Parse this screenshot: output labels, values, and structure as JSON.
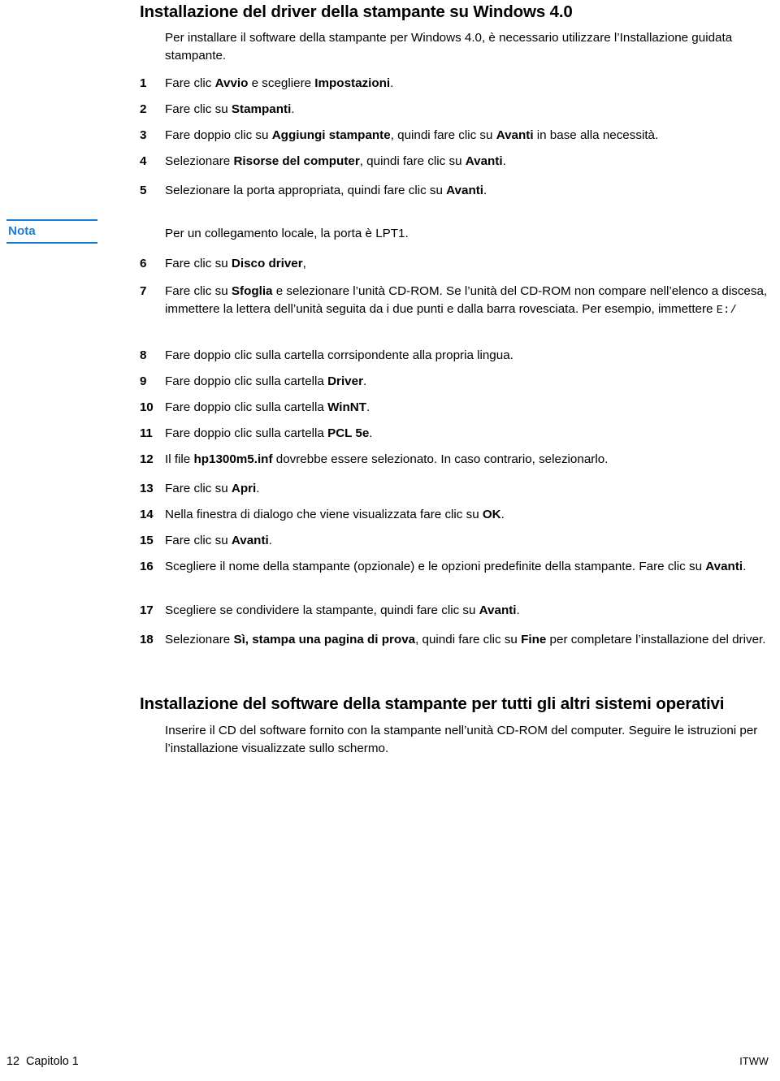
{
  "document": {
    "language": "it",
    "accent_color": "#1a7fd4",
    "text_color": "#000000",
    "background_color": "#ffffff"
  },
  "section_one": {
    "heading": "Installazione del driver della stampante su Windows 4.0",
    "intro": "Per installare il software della stampante per Windows 4.0, è necessario utilizzare l’Installazione guidata stampante.",
    "steps_before_note": [
      {
        "number": "1",
        "parts": [
          {
            "text": "Fare clic ",
            "bold": false
          },
          {
            "text": "Avvio",
            "bold": true
          },
          {
            "text": " e scegliere ",
            "bold": false
          },
          {
            "text": "Impostazioni",
            "bold": true
          },
          {
            "text": ".",
            "bold": false
          }
        ]
      },
      {
        "number": "2",
        "parts": [
          {
            "text": "Fare clic su ",
            "bold": false
          },
          {
            "text": "Stampanti",
            "bold": true
          },
          {
            "text": ".",
            "bold": false
          }
        ]
      },
      {
        "number": "3",
        "parts": [
          {
            "text": "Fare doppio clic su ",
            "bold": false
          },
          {
            "text": "Aggiungi stampante",
            "bold": true
          },
          {
            "text": ", quindi fare clic su ",
            "bold": false
          },
          {
            "text": "Avanti",
            "bold": true
          },
          {
            "text": " in base alla necessità.",
            "bold": false
          }
        ]
      },
      {
        "number": "4",
        "parts": [
          {
            "text": "Selezionare ",
            "bold": false
          },
          {
            "text": "Risorse del computer",
            "bold": true
          },
          {
            "text": ", quindi fare clic su ",
            "bold": false
          },
          {
            "text": "Avanti",
            "bold": true
          },
          {
            "text": ".",
            "bold": false
          }
        ]
      },
      {
        "number": "5",
        "parts": [
          {
            "text": "Selezionare la porta appropriata, quindi fare clic su ",
            "bold": false
          },
          {
            "text": "Avanti",
            "bold": true
          },
          {
            "text": ".",
            "bold": false
          }
        ]
      }
    ],
    "note": {
      "label": "Nota",
      "text": "Per un collegamento locale, la porta è LPT1."
    },
    "steps_after_note": [
      {
        "number": "6",
        "parts": [
          {
            "text": "Fare clic su ",
            "bold": false
          },
          {
            "text": "Disco driver",
            "bold": true
          },
          {
            "text": ",",
            "bold": false
          }
        ]
      },
      {
        "number": "7",
        "parts": [
          {
            "text": "Fare clic su ",
            "bold": false
          },
          {
            "text": "Sfoglia",
            "bold": true
          },
          {
            "text": " e selezionare l’unità CD-ROM. Se l’unità del CD-ROM non compare nell’elenco a discesa, immettere la lettera dell’unità seguita da i due punti e dalla barra rovesciata. Per esempio, immettere ",
            "bold": false
          },
          {
            "text": "E:/",
            "bold": false,
            "mono": true
          }
        ]
      },
      {
        "number": "8",
        "parts": [
          {
            "text": "Fare doppio clic sulla cartella corrsipondente alla propria lingua.",
            "bold": false
          }
        ]
      },
      {
        "number": "9",
        "parts": [
          {
            "text": "Fare doppio clic sulla cartella ",
            "bold": false
          },
          {
            "text": "Driver",
            "bold": true
          },
          {
            "text": ".",
            "bold": false
          }
        ]
      },
      {
        "number": "10",
        "parts": [
          {
            "text": "Fare doppio clic sulla cartella ",
            "bold": false
          },
          {
            "text": "WinNT",
            "bold": true
          },
          {
            "text": ".",
            "bold": false
          }
        ]
      },
      {
        "number": "11",
        "parts": [
          {
            "text": "Fare doppio clic sulla cartella ",
            "bold": false
          },
          {
            "text": "PCL 5e",
            "bold": true
          },
          {
            "text": ".",
            "bold": false
          }
        ]
      },
      {
        "number": "12",
        "parts": [
          {
            "text": "Il file ",
            "bold": false
          },
          {
            "text": "hp1300m5.inf",
            "bold": true
          },
          {
            "text": " dovrebbe essere selezionato. In caso contrario, selezionarlo.",
            "bold": false
          }
        ]
      },
      {
        "number": "13",
        "parts": [
          {
            "text": "Fare clic su ",
            "bold": false
          },
          {
            "text": "Apri",
            "bold": true
          },
          {
            "text": ".",
            "bold": false
          }
        ]
      },
      {
        "number": "14",
        "parts": [
          {
            "text": "Nella finestra di dialogo che viene visualizzata fare clic su ",
            "bold": false
          },
          {
            "text": "OK",
            "bold": true
          },
          {
            "text": ".",
            "bold": false
          }
        ]
      },
      {
        "number": "15",
        "parts": [
          {
            "text": "Fare clic su ",
            "bold": false
          },
          {
            "text": "Avanti",
            "bold": true
          },
          {
            "text": ".",
            "bold": false
          }
        ]
      },
      {
        "number": "16",
        "parts": [
          {
            "text": "Scegliere il nome della stampante (opzionale) e le opzioni predefinite della stampante. Fare clic su ",
            "bold": false
          },
          {
            "text": "Avanti",
            "bold": true
          },
          {
            "text": ".",
            "bold": false
          }
        ]
      },
      {
        "number": "17",
        "parts": [
          {
            "text": "Scegliere se condividere la stampante, quindi fare clic su ",
            "bold": false
          },
          {
            "text": "Avanti",
            "bold": true
          },
          {
            "text": ".",
            "bold": false
          }
        ]
      },
      {
        "number": "18",
        "parts": [
          {
            "text": "Selezionare ",
            "bold": false
          },
          {
            "text": "Sì, stampa una pagina di prova",
            "bold": true
          },
          {
            "text": ", quindi fare clic su ",
            "bold": false
          },
          {
            "text": "Fine",
            "bold": true
          },
          {
            "text": " per completare l’installazione del driver.",
            "bold": false
          }
        ]
      }
    ]
  },
  "section_two": {
    "heading": "Installazione del software della stampante per tutti gli altri sistemi operativi",
    "paragraph": "Inserire il CD del software fornito con la stampante nell’unità CD-ROM del computer. Seguire le istruzioni per l’installazione visualizzate sullo schermo."
  },
  "footer": {
    "left": "12  Capitolo 1",
    "right": "ITWW"
  }
}
